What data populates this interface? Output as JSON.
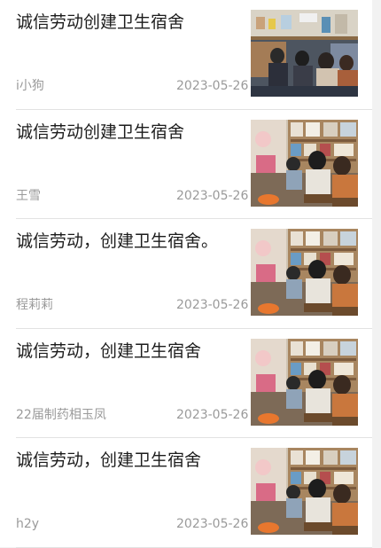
{
  "articles": [
    {
      "title": "诚信劳动创建卫生宿舍",
      "author": "i小狗",
      "date": "2023-05-26",
      "thumb_icon": "dorm-photo-1"
    },
    {
      "title": "诚信劳动创建卫生宿舍",
      "author": "王雪",
      "date": "2023-05-26",
      "thumb_icon": "dorm-photo-2"
    },
    {
      "title": "诚信劳动，创建卫生宿舍。",
      "author": "程莉莉",
      "date": "2023-05-26",
      "thumb_icon": "dorm-photo-2"
    },
    {
      "title": "诚信劳动，创建卫生宿舍",
      "author": "22届制药相玉凤",
      "date": "2023-05-26",
      "thumb_icon": "dorm-photo-2"
    },
    {
      "title": "诚信劳动，创建卫生宿舍",
      "author": "h2y",
      "date": "2023-05-26",
      "thumb_icon": "dorm-photo-2"
    }
  ],
  "colors": {
    "title_text": "#1c1c1c",
    "meta_text": "#9a9a9a",
    "divider": "#e2e2e2",
    "background": "#ffffff"
  }
}
